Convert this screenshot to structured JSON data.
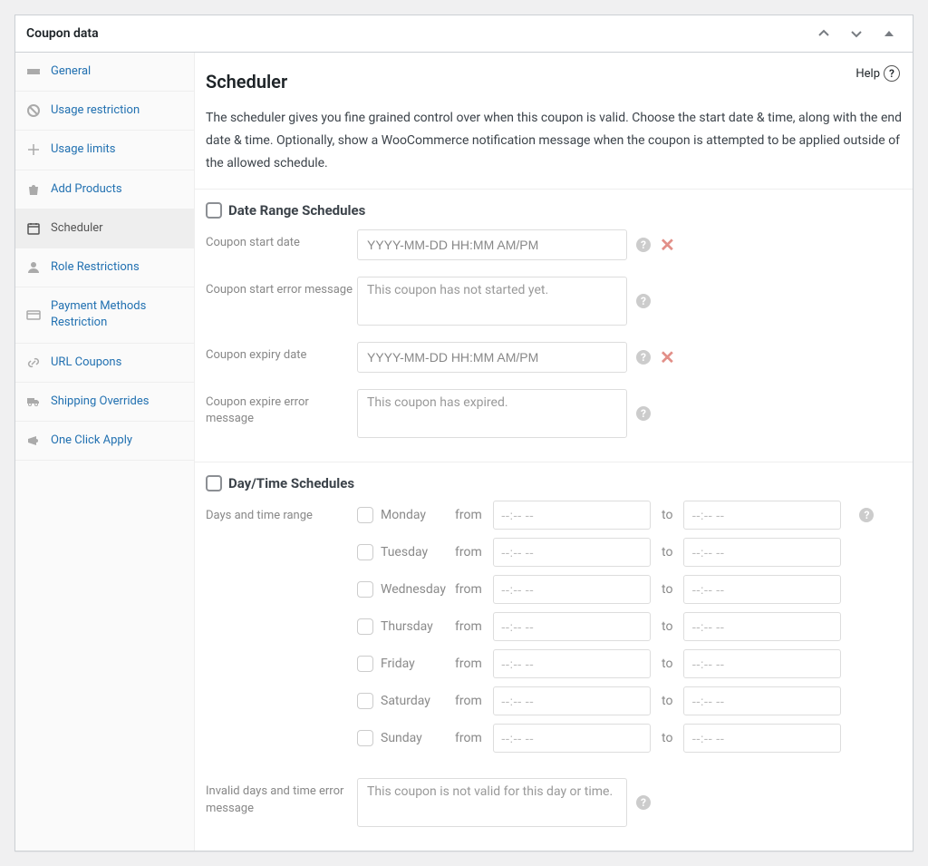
{
  "box_title": "Coupon data",
  "help_label": "Help",
  "tabs": [
    {
      "label": "General"
    },
    {
      "label": "Usage restriction"
    },
    {
      "label": "Usage limits"
    },
    {
      "label": "Add Products"
    },
    {
      "label": "Scheduler"
    },
    {
      "label": "Role Restrictions"
    },
    {
      "label": "Payment Methods Restriction"
    },
    {
      "label": "URL Coupons"
    },
    {
      "label": "Shipping Overrides"
    },
    {
      "label": "One Click Apply"
    }
  ],
  "scheduler": {
    "title": "Scheduler",
    "desc": "The scheduler gives you fine grained control over when this coupon is valid. Choose the start date & time, along with the end date & time. Optionally, show a WooCommerce notification message when the coupon is attempted to be applied outside of the allowed schedule.",
    "date_range": {
      "heading": "Date Range Schedules",
      "start_date_label": "Coupon start date",
      "start_date_placeholder": "YYYY-MM-DD HH:MM AM/PM",
      "start_err_label": "Coupon start error message",
      "start_err_placeholder": "This coupon has not started yet.",
      "expiry_label": "Coupon expiry date",
      "expiry_placeholder": "YYYY-MM-DD HH:MM AM/PM",
      "expiry_err_label": "Coupon expire error message",
      "expiry_err_placeholder": "This coupon has expired."
    },
    "daytime": {
      "heading": "Day/Time Schedules",
      "rows_label": "Days and time range",
      "from": "from",
      "to": "to",
      "time_placeholder": "--:-- --",
      "days": [
        "Monday",
        "Tuesday",
        "Wednesday",
        "Thursday",
        "Friday",
        "Saturday",
        "Sunday"
      ],
      "invalid_label": "Invalid days and time error message",
      "invalid_placeholder": "This coupon is not valid for this day or time."
    }
  }
}
